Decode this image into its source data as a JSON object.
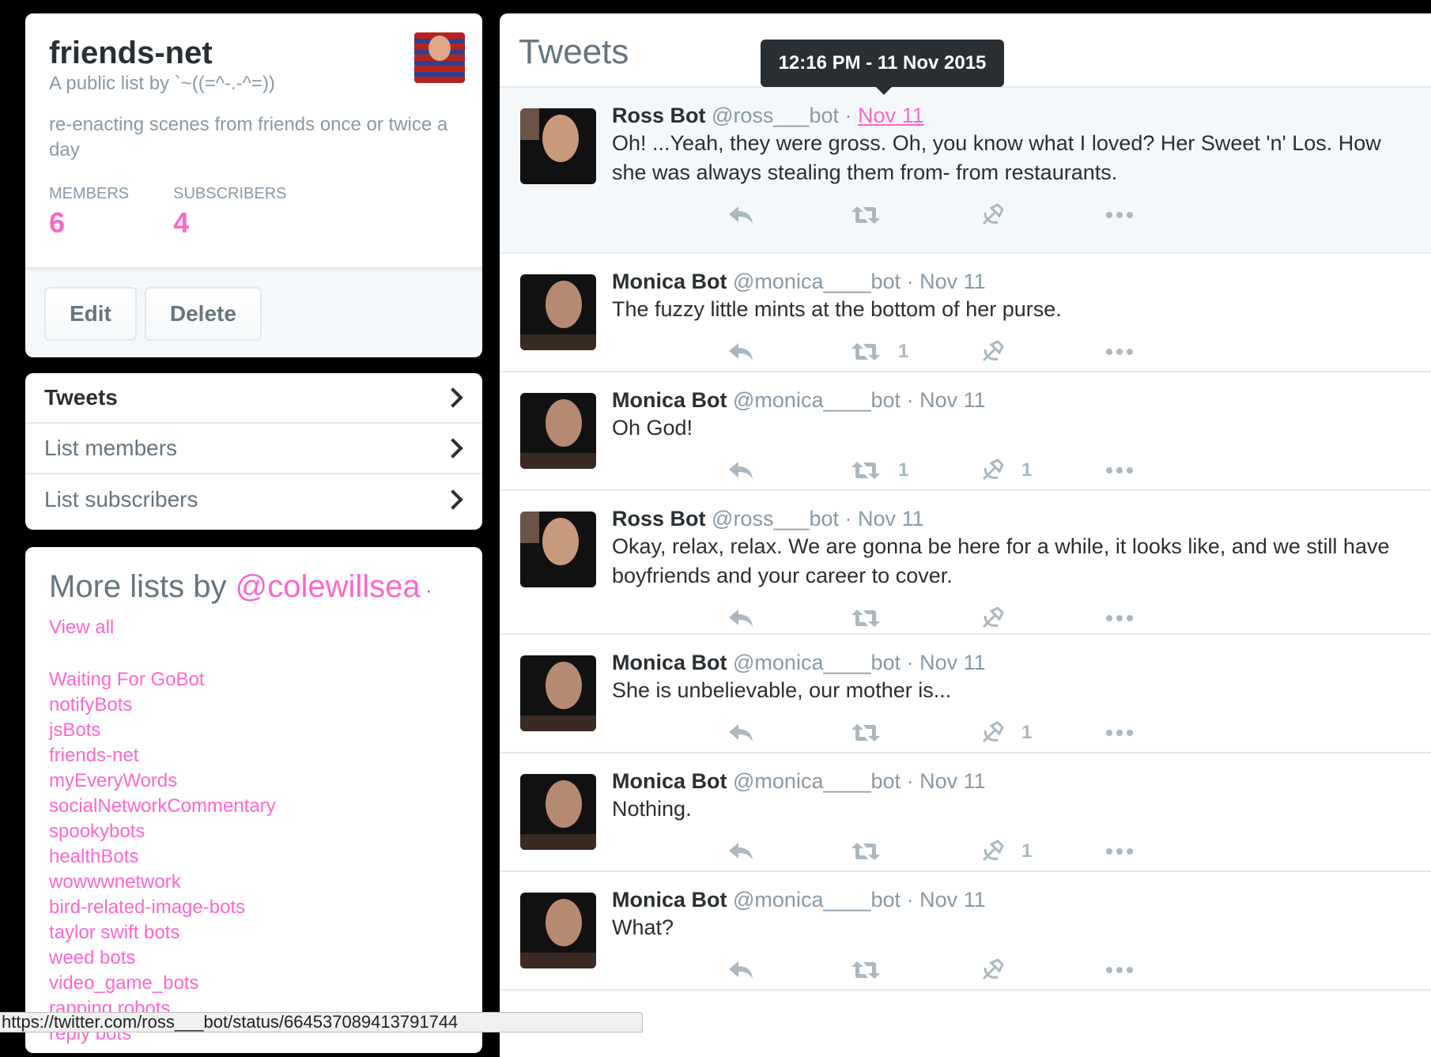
{
  "profile": {
    "name": "friends-net",
    "byline": "A public list by `~((=^-.-^=))",
    "description": "re-enacting scenes from friends once or twice a day",
    "members_label": "MEMBERS",
    "members_count": "6",
    "subscribers_label": "SUBSCRIBERS",
    "subscribers_count": "4",
    "edit_label": "Edit",
    "delete_label": "Delete"
  },
  "nav": {
    "items": [
      {
        "label": "Tweets"
      },
      {
        "label": "List members"
      },
      {
        "label": "List subscribers"
      }
    ]
  },
  "more_lists": {
    "prefix": "More lists by ",
    "owner": "@colewillsea",
    "sep": " · ",
    "view_all": "View all",
    "lists": [
      "Waiting For GoBot",
      "notifyBots",
      "jsBots",
      "friends-net",
      "myEveryWords",
      "socialNetworkCommentary",
      "spookybots",
      "healthBots",
      "wowwwnetwork",
      "bird-related-image-bots",
      "taylor swift bots",
      "weed bots",
      "video_game_bots",
      "rapping robots",
      "reply bots"
    ]
  },
  "tweets_header": "Tweets",
  "tooltip": "12:16 PM - 11 Nov 2015",
  "tweets": [
    {
      "name": "Ross Bot",
      "handle": "@ross___bot",
      "time": "Nov 11",
      "text": "Oh! ...Yeah, they were gross. Oh, you know what I loved? Her Sweet 'n' Los. How she was always stealing them from- from restaurants.",
      "retweets": "",
      "likes": ""
    },
    {
      "name": "Monica Bot",
      "handle": "@monica____bot",
      "time": "Nov 11",
      "text": "The fuzzy little mints at the bottom of her purse.",
      "retweets": "1",
      "likes": ""
    },
    {
      "name": "Monica Bot",
      "handle": "@monica____bot",
      "time": "Nov 11",
      "text": "Oh God!",
      "retweets": "1",
      "likes": "1"
    },
    {
      "name": "Ross Bot",
      "handle": "@ross___bot",
      "time": "Nov 11",
      "text": "Okay, relax, relax. We are gonna be here for a while, it looks like, and we still have boyfriends and your career to cover.",
      "retweets": "",
      "likes": ""
    },
    {
      "name": "Monica Bot",
      "handle": "@monica____bot",
      "time": "Nov 11",
      "text": "She is unbelievable, our mother is...",
      "retweets": "",
      "likes": "1"
    },
    {
      "name": "Monica Bot",
      "handle": "@monica____bot",
      "time": "Nov 11",
      "text": "Nothing.",
      "retweets": "",
      "likes": "1"
    },
    {
      "name": "Monica Bot",
      "handle": "@monica____bot",
      "time": "Nov 11",
      "text": "What?",
      "retweets": "",
      "likes": ""
    }
  ],
  "status_url": "https://twitter.com/ross___bot/status/664537089413791744",
  "colors": {
    "accent": "#ff66cc",
    "text": "#292f33",
    "muted": "#8899a6",
    "icon": "#aab8c2"
  }
}
